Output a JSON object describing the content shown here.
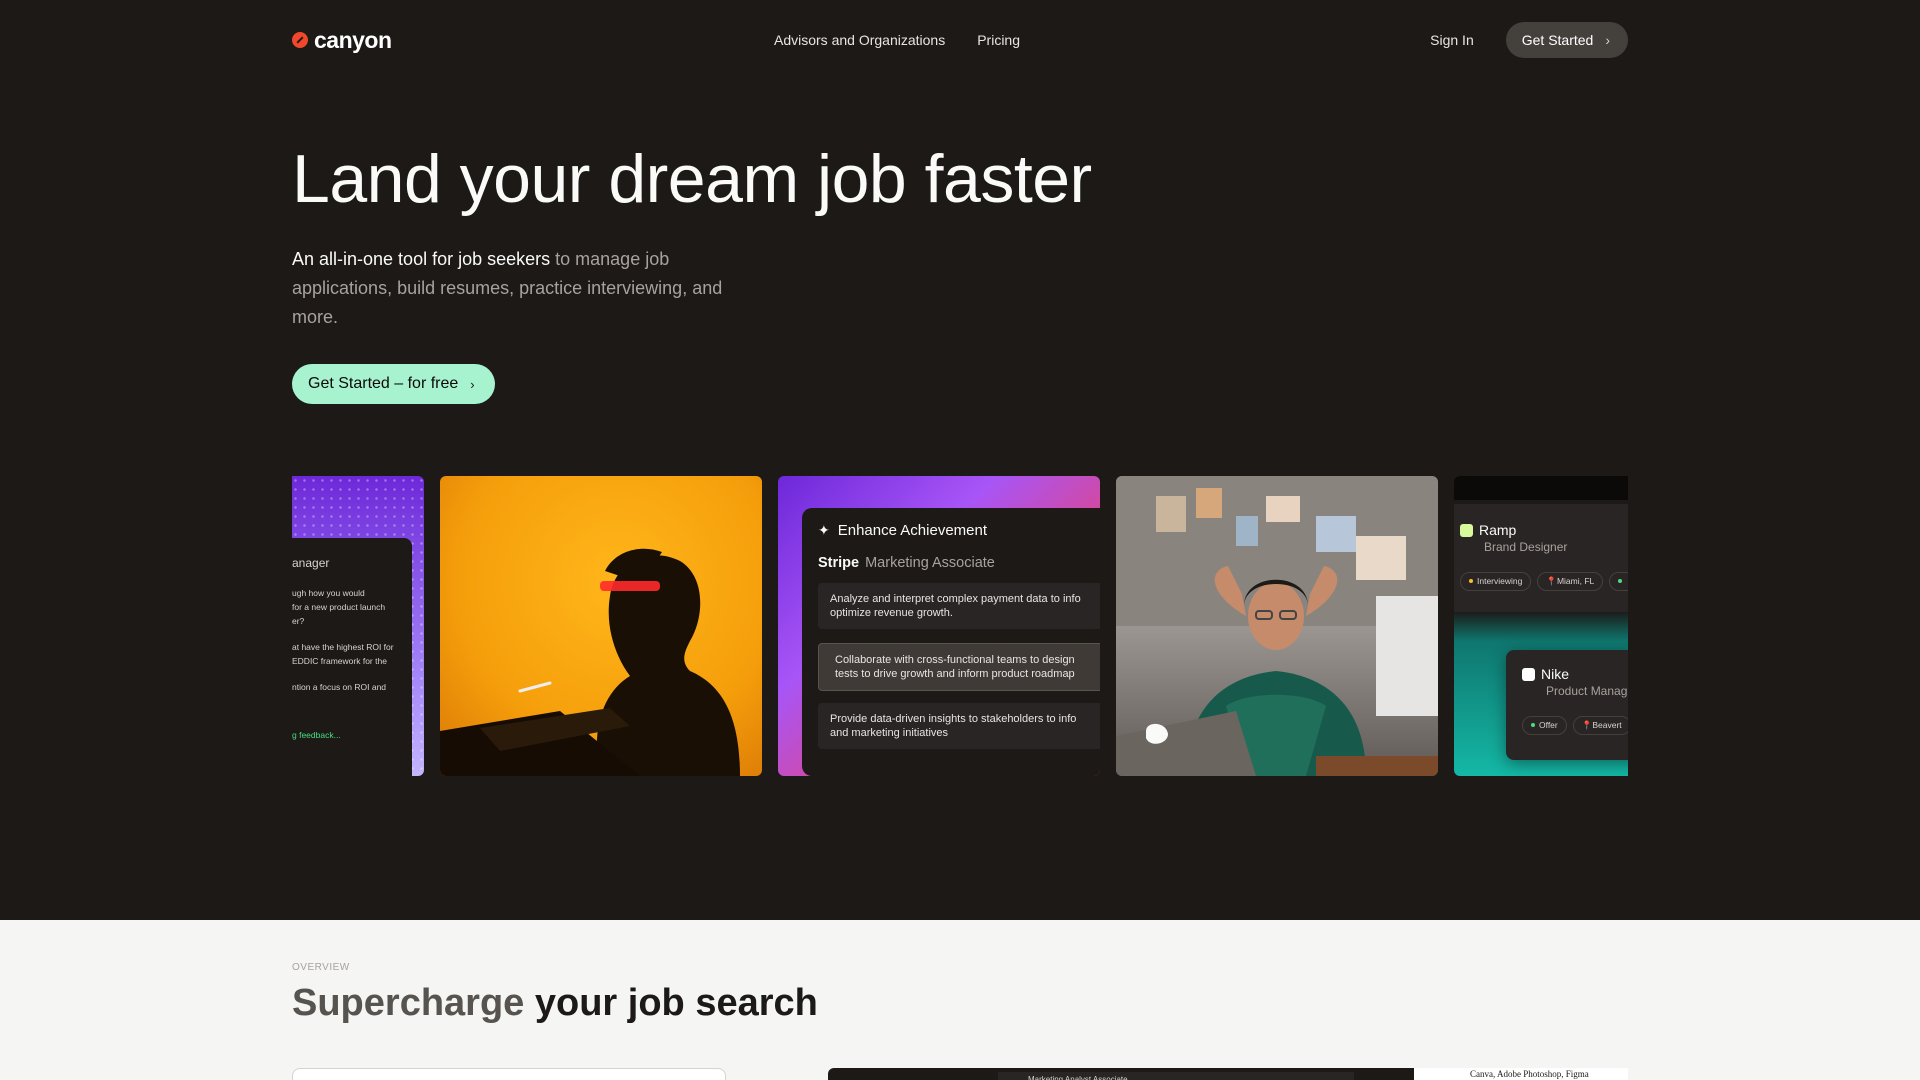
{
  "nav": {
    "logo_text": "canyon",
    "links": [
      "Advisors and Organizations",
      "Pricing"
    ],
    "sign_in": "Sign In",
    "cta": "Get Started"
  },
  "hero": {
    "title": "Land your dream job faster",
    "subtitle_strong": "An all-in-one tool for job seekers",
    "subtitle_rest": " to manage job applications, build resumes, practice interviewing, and more.",
    "cta": "Get Started – for free"
  },
  "gallery": {
    "interview_card": {
      "title": "anager",
      "lines": [
        "ugh how you would",
        "for a new product launch",
        "er?"
      ],
      "lines2": [
        "at have the highest ROI for",
        "EDDIC framework for the"
      ],
      "line3": "ntion a focus on ROI and",
      "link": "g feedback..."
    },
    "achievement_card": {
      "heading": "Enhance Achievement",
      "company": "Stripe",
      "role": "Marketing Associate",
      "bullets": [
        "Analyze and interpret complex payment data to info optimize revenue growth.",
        "Collaborate with cross-functional teams to design tests to drive growth and inform product roadmap",
        "Provide data-driven insights to stakeholders to info and marketing initiatives"
      ],
      "bullet_lines": [
        [
          "Analyze and interpret complex payment data to info",
          "optimize revenue growth."
        ],
        [
          "Collaborate with cross-functional teams to design",
          "tests to drive growth and inform product roadmap"
        ],
        [
          "Provide data-driven insights to stakeholders to info",
          "and marketing initiatives"
        ]
      ]
    },
    "tracker_card": {
      "job1": {
        "company": "Ramp",
        "role": "Brand Designer",
        "status": "Interviewing",
        "location": "Miami, FL",
        "color": "#d9f99d"
      },
      "job2": {
        "company": "Nike",
        "role": "Product Manag",
        "status": "Offer",
        "location": "Beavert",
        "color": "#ffffff"
      }
    }
  },
  "overview": {
    "label": "OVERVIEW",
    "title_muted": "Supercharge",
    "title_rest": " your job search",
    "preview_job": "Marketing Analyst Associate",
    "preview_skills": "Canva, Adobe Photoshop, Figma"
  },
  "colors": {
    "background": "#1c1917",
    "accent_mint": "#a7f3d0",
    "logo": "#f0482a",
    "overview_bg": "#f5f5f4"
  }
}
